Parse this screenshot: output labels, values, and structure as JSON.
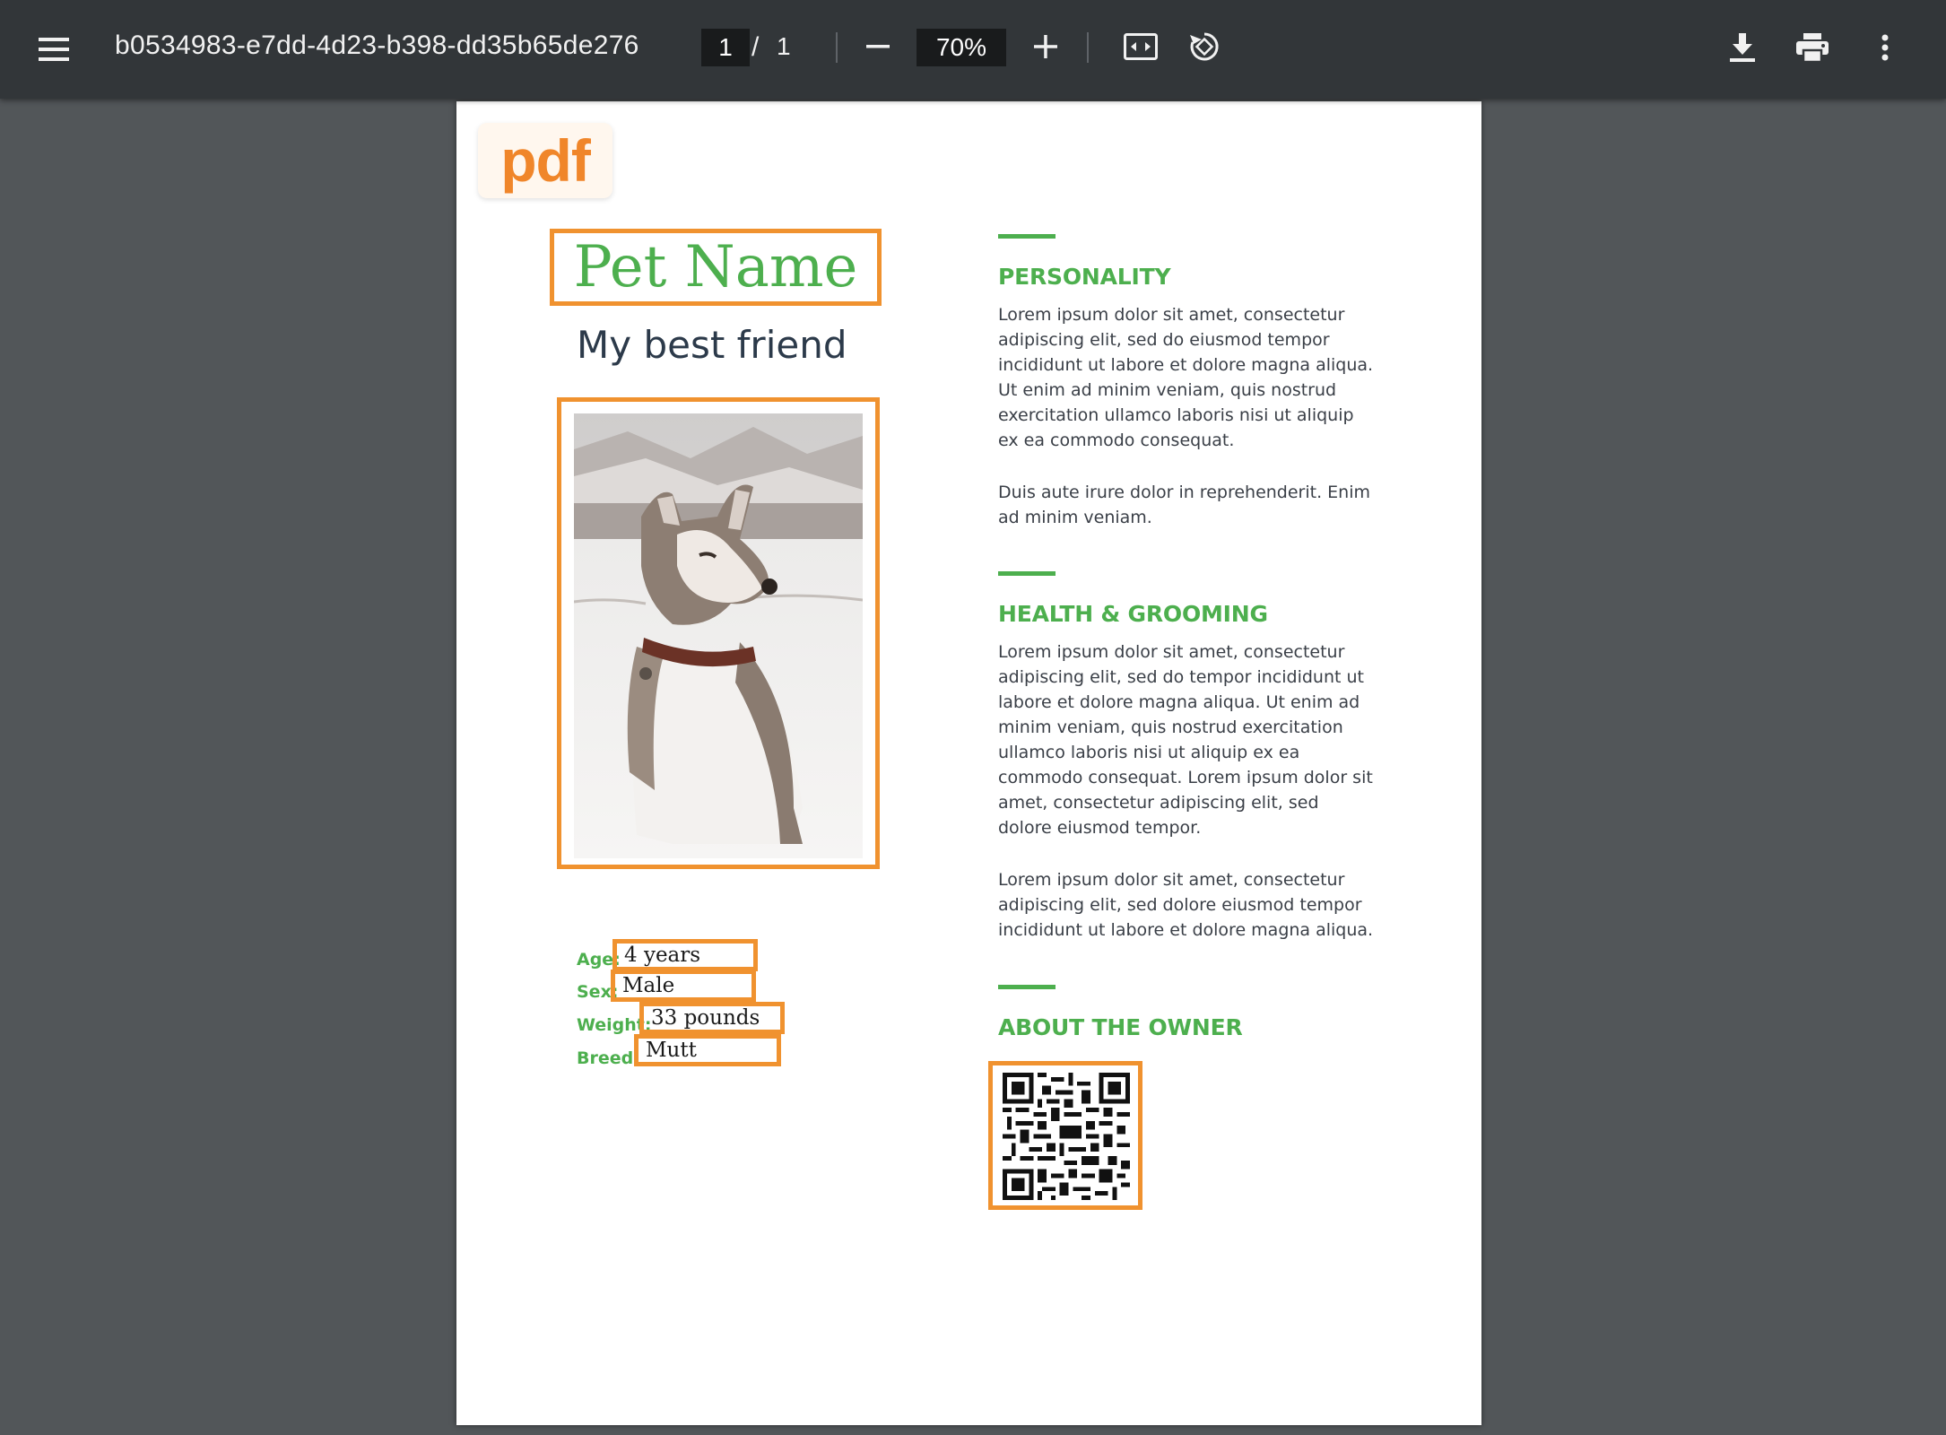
{
  "viewer": {
    "file_name": "b0534983-e7dd-4d23-b398-dd35b65de276",
    "current_page": "1",
    "page_separator": "/",
    "total_pages": "1",
    "zoom": "70%"
  },
  "icons": {
    "menu": "menu-icon",
    "zoom_out": "minus-icon",
    "zoom_in": "plus-icon",
    "fit": "fit-to-page-icon",
    "rotate": "rotate-icon",
    "download": "download-icon",
    "print": "printer-icon",
    "more": "more-vertical-icon"
  },
  "document": {
    "logo_text": "pdf",
    "pet_name": "Pet Name",
    "subtitle": "My best friend",
    "fields": [
      {
        "label": "Age:",
        "value": "4 years"
      },
      {
        "label": "Sex:",
        "value": "Male"
      },
      {
        "label": "Weight:",
        "value": "33 pounds"
      },
      {
        "label": "Breed:",
        "value": "Mutt"
      }
    ],
    "sections": [
      {
        "title": "PERSONALITY",
        "paragraphs": [
          "Lorem ipsum dolor sit amet, consectetur adipiscing elit, sed do eiusmod tempor incididunt ut labore et dolore magna aliqua. Ut enim ad minim veniam, quis nostrud exercitation ullamco laboris nisi ut aliquip ex ea commodo consequat.",
          "Duis aute irure dolor in reprehenderit. Enim ad minim veniam."
        ]
      },
      {
        "title": "HEALTH & GROOMING",
        "paragraphs": [
          "Lorem ipsum dolor sit amet, consectetur adipiscing elit, sed do tempor incididunt ut labore et dolore magna aliqua. Ut enim ad minim veniam, quis nostrud exercitation ullamco laboris nisi ut aliquip ex ea commodo consequat. Lorem ipsum dolor sit amet, consectetur adipiscing elit, sed dolore eiusmod tempor.",
          "Lorem ipsum dolor sit amet, consectetur adipiscing elit, sed dolore eiusmod tempor incididunt ut labore et dolore magna aliqua."
        ]
      },
      {
        "title": "ABOUT THE OWNER",
        "paragraphs": []
      }
    ]
  },
  "colors": {
    "toolbar": "#323639",
    "viewer_background": "#525659",
    "accent_green": "#4daf4e",
    "highlight_orange": "#f0922f",
    "logo_orange": "#f0862a"
  }
}
